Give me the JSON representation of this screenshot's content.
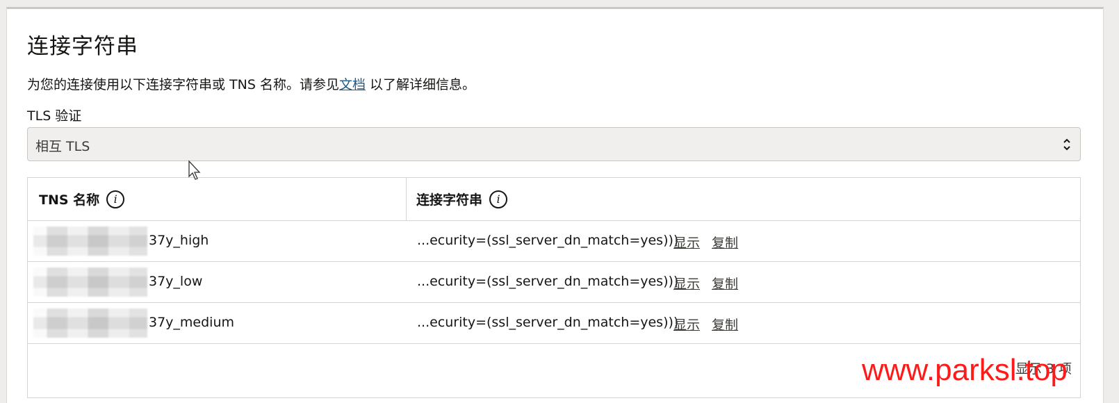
{
  "page": {
    "title": "连接字符串",
    "description_prefix": "为您的连接使用以下连接字符串或 TNS 名称。请参见",
    "description_link": "文档",
    "description_suffix": " 以了解详细信息。"
  },
  "tls": {
    "label": "TLS 验证",
    "selected": "相互 TLS"
  },
  "table": {
    "columns": [
      "TNS 名称",
      "连接字符串"
    ],
    "rows": [
      {
        "tns_name": "37y_high",
        "connection": "...ecurity=(ssl_server_dn_match=yes)))",
        "show": "显示",
        "copy": "复制"
      },
      {
        "tns_name": "37y_low",
        "connection": "...ecurity=(ssl_server_dn_match=yes)))",
        "show": "显示",
        "copy": "复制"
      },
      {
        "tns_name": "37y_medium",
        "connection": "...ecurity=(ssl_server_dn_match=yes)))",
        "show": "显示",
        "copy": "复制"
      }
    ],
    "count_label": "显示 3 项"
  },
  "watermark": "www.parksl.top",
  "colors": {
    "link": "#1a5c8a",
    "watermark": "#ff1a1a",
    "select_bg": "#f1efed"
  },
  "icons": {
    "info": "info-icon",
    "select_chevron": "updown-chevron-icon",
    "cursor": "mouse-pointer-icon"
  }
}
